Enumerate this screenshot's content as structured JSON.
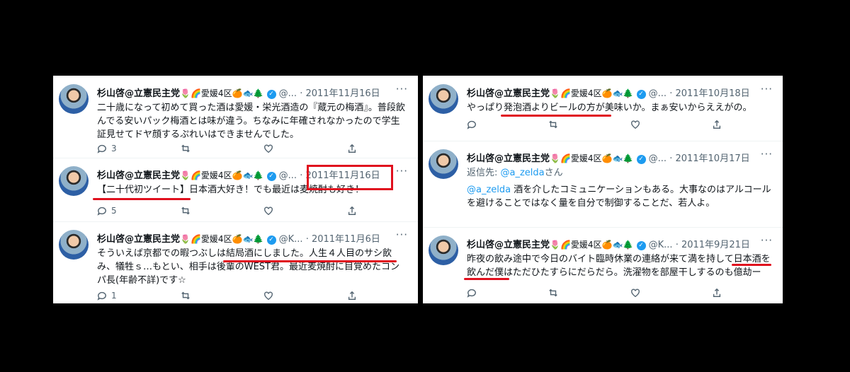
{
  "colors": {
    "highlight": "#e0101e",
    "verified": "#1d9bf0",
    "link": "#1d9bf0"
  },
  "left_tweets": [
    {
      "name": "杉山啓@立憲民主党",
      "emojis": "🌷🌈愛媛4区🍊🐟🌲",
      "handle": "@...",
      "date": "· 2011年11月16日",
      "text": "二十歳になって初めて買った酒は愛媛・栄光酒造の『蔵元の梅酒』。普段飲んでる安いパック梅酒とは味が違う。ちなみに年確されなかったので学生証見せてドヤ顔するぷれいはできませんでした。",
      "reply_count": "3",
      "retweet_count": "",
      "like_count": ""
    },
    {
      "name": "杉山啓@立憲民主党",
      "emojis": "🌷🌈愛媛4区🍊🐟🌲",
      "handle": "@...",
      "date": "· 2011年11月16日",
      "text": "【二十代初ツイート】日本酒大好き！でも最近は麦焼酎も好き！",
      "reply_count": "5",
      "retweet_count": "",
      "like_count": ""
    },
    {
      "name": "杉山啓@立憲民主党",
      "emojis": "🌷🌈愛媛4区🍊🐟🌲",
      "handle": "@K...",
      "date": "· 2011年11月6日",
      "text": "そういえば京都での暇つぶしは結局酒にしました。人生４人目のサシ飲み、犠牲ｓ…もとい、相手は後輩のWEST君。最近麦焼酎に目覚めたコンパ長(年齢不詳)です☆",
      "reply_count": "1",
      "retweet_count": "",
      "like_count": ""
    }
  ],
  "right_tweets": [
    {
      "name": "杉山啓@立憲民主党",
      "emojis": "🌷🌈愛媛4区🍊🐟🌲",
      "handle": "@...",
      "date": "· 2011年10月18日",
      "text": "やっぱり発泡酒よりビールの方が美味いか。まぁ安いからええがの。",
      "reply_count": "",
      "retweet_count": "",
      "like_count": ""
    },
    {
      "name": "杉山啓@立憲民主党",
      "emojis": "🌷🌈愛媛4区🍊🐟🌲",
      "handle": "@...",
      "date": "· 2011年10月17日",
      "reply_prefix": "返信先: ",
      "reply_to": "@a_zelda",
      "reply_suffix": "さん",
      "mention": "@a_zelda",
      "text": " 酒を介したコミュニケーションもある。大事なのはアルコールを避けることではなく量を自分で制御することだ、若人よ。",
      "reply_count": "",
      "retweet_count": "",
      "like_count": ""
    },
    {
      "name": "杉山啓@立憲民主党",
      "emojis": "🌷🌈愛媛4区🍊🐟🌲",
      "handle": "@K...",
      "date": "· 2011年9月21日",
      "text": "昨夜の飲み途中で今日のバイト臨時休業の連絡が来て満を持して日本酒を飲んだ僕はただひたすらにだらだら。洗濯物を部屋干しするのも億劫ー",
      "reply_count": "",
      "retweet_count": "",
      "like_count": ""
    }
  ]
}
